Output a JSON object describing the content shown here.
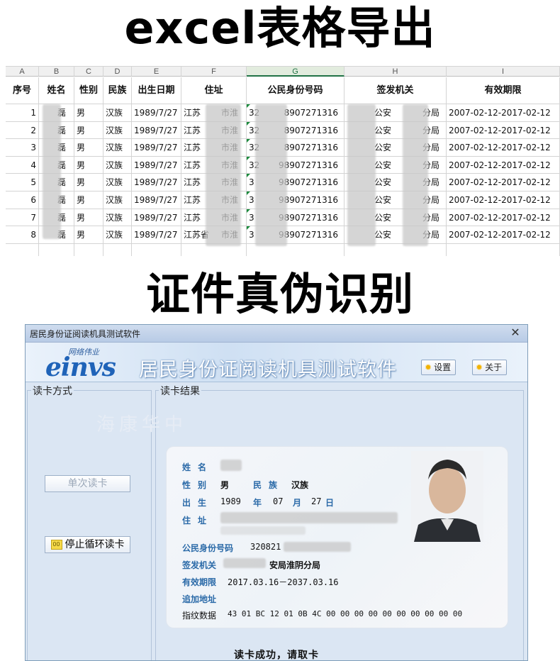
{
  "banners": {
    "top": "excel表格导出",
    "middle": "证件真伪识别"
  },
  "sheet": {
    "columns": [
      "A",
      "B",
      "C",
      "D",
      "E",
      "F",
      "G",
      "H",
      "I"
    ],
    "selected_column": "G",
    "headers": [
      "序号",
      "姓名",
      "性别",
      "民族",
      "出生日期",
      "住址",
      "公民身份号码",
      "签发机关",
      "有效期限"
    ],
    "rows": [
      {
        "no": "1",
        "name": "磊",
        "sex": "男",
        "nation": "汉族",
        "dob": "1989/7/27",
        "addr_a": "江苏",
        "addr_b": "市淮",
        "id_a": "32",
        "id_b": "8907271316",
        "org_a": "公安",
        "org_b": "分局",
        "valid": "2007-02-12-2017-02-12"
      },
      {
        "no": "2",
        "name": "磊",
        "sex": "男",
        "nation": "汉族",
        "dob": "1989/7/27",
        "addr_a": "江苏",
        "addr_b": "市淮",
        "id_a": "32",
        "id_b": "8907271316",
        "org_a": "公安",
        "org_b": "分局",
        "valid": "2007-02-12-2017-02-12"
      },
      {
        "no": "3",
        "name": "磊",
        "sex": "男",
        "nation": "汉族",
        "dob": "1989/7/27",
        "addr_a": "江苏",
        "addr_b": "市淮",
        "id_a": "32",
        "id_b": "8907271316",
        "org_a": "公安",
        "org_b": "分局",
        "valid": "2007-02-12-2017-02-12"
      },
      {
        "no": "4",
        "name": "磊",
        "sex": "男",
        "nation": "汉族",
        "dob": "1989/7/27",
        "addr_a": "江苏",
        "addr_b": "市淮",
        "id_a": "32",
        "id_b": "98907271316",
        "org_a": "公安",
        "org_b": "分局",
        "valid": "2007-02-12-2017-02-12"
      },
      {
        "no": "5",
        "name": "磊",
        "sex": "男",
        "nation": "汉族",
        "dob": "1989/7/27",
        "addr_a": "江苏",
        "addr_b": "市淮",
        "id_a": "3",
        "id_b": "98907271316",
        "org_a": "公安",
        "org_b": "分局",
        "valid": "2007-02-12-2017-02-12"
      },
      {
        "no": "6",
        "name": "磊",
        "sex": "男",
        "nation": "汉族",
        "dob": "1989/7/27",
        "addr_a": "江苏",
        "addr_b": "市淮",
        "id_a": "3",
        "id_b": "98907271316",
        "org_a": "公安",
        "org_b": "分局",
        "valid": "2007-02-12-2017-02-12"
      },
      {
        "no": "7",
        "name": "磊",
        "sex": "男",
        "nation": "汉族",
        "dob": "1989/7/27",
        "addr_a": "江苏",
        "addr_b": "市淮",
        "id_a": "3",
        "id_b": "98907271316",
        "org_a": "公安",
        "org_b": "分局",
        "valid": "2007-02-12-2017-02-12"
      },
      {
        "no": "8",
        "name": "磊",
        "sex": "男",
        "nation": "汉族",
        "dob": "1989/7/27",
        "addr_a": "江苏省",
        "addr_b": "市淮",
        "id_a": "3",
        "id_b": "98907271316",
        "org_a": "公安",
        "org_b": "分局",
        "valid": "2007-02-12-2017-02-12"
      }
    ]
  },
  "window": {
    "title": "居民身份证阅读机具测试软件",
    "logo_cn": "网络伟业",
    "logo_en": "einvs",
    "app_title": "居民身份证阅读机具测试软件",
    "settings_label": "设置",
    "about_label": "关于",
    "read_mode_label": "读卡方式",
    "result_label": "读卡结果",
    "watermark": "海康华中",
    "single_read_label": "单次读卡",
    "stop_loop_label": "停止循环读卡",
    "status": "读卡成功，请取卡",
    "close_glyph": "✕"
  },
  "card": {
    "name_label": "姓名",
    "sex_label": "性别",
    "sex_value": "男",
    "nation_label": "民族",
    "nation_value": "汉族",
    "birth_label": "出生",
    "birth_year": "1989",
    "year_char": "年",
    "birth_month": "07",
    "month_char": "月",
    "birth_day": "27",
    "day_char": "日",
    "address_label": "住址",
    "id_label": "公民身份号码",
    "id_value": "320821",
    "issuer_label": "签发机关",
    "issuer_value": "安局淮阴分局",
    "validity_label": "有效期限",
    "validity_value": "2017.03.16－2037.03.16",
    "extra_address_label": "追加地址",
    "fingerprint_label": "指纹数据",
    "fingerprint_value": "43 01 BC 12 01 0B 4C 00 00 00 00 00 00 00 00 00 00"
  },
  "colors": {
    "accent": "#1f63b8",
    "label_blue": "#2b6aa8",
    "excel_green": "#217346"
  }
}
